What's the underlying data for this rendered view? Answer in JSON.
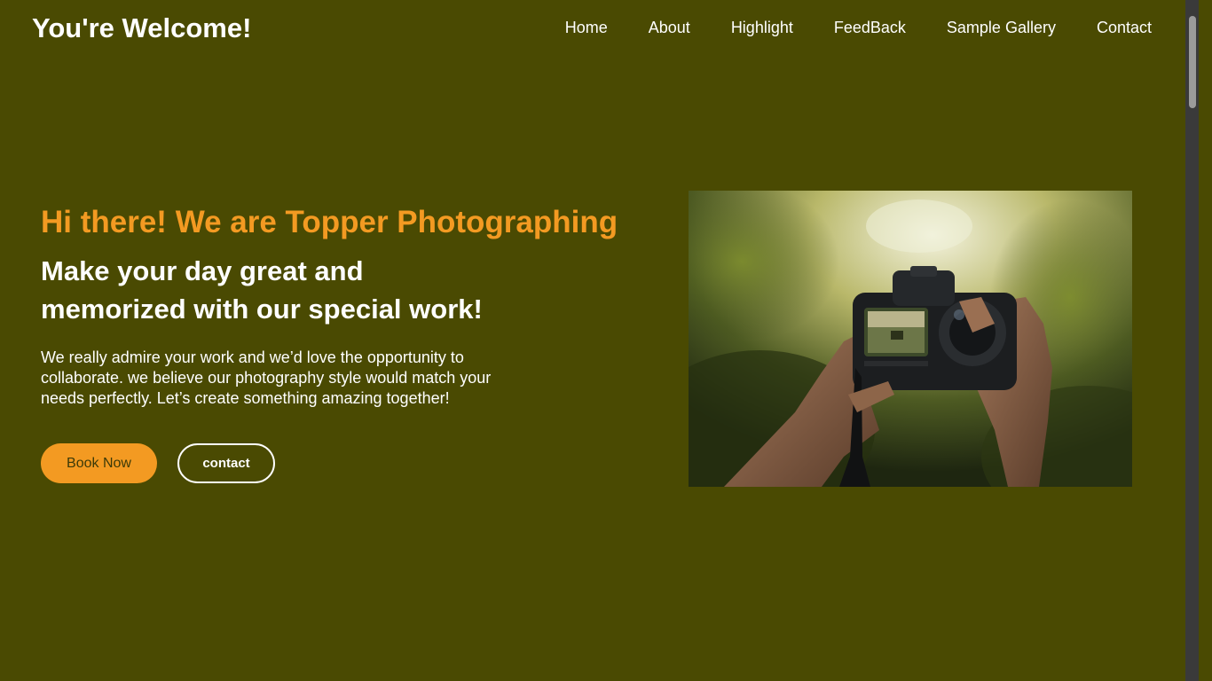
{
  "header": {
    "brand": "You're Welcome!",
    "nav": [
      "Home",
      "About",
      "Highlight",
      "FeedBack",
      "Sample Gallery",
      "Contact"
    ]
  },
  "hero": {
    "title": "Hi there! We are Topper Photographing",
    "subtitle_lines": [
      "Make your day great and",
      "memorized with our special work!"
    ],
    "body_lines": [
      "We really admire your work and we’d love the opportunity to",
      "collaborate. we believe our photography style would match your",
      "needs perfectly. Let’s create something amazing together!"
    ],
    "book_label": "Book Now",
    "contact_label": "contact"
  },
  "colors": {
    "background": "#4a4a02",
    "accent": "#f39a22",
    "text": "#ffffff"
  }
}
